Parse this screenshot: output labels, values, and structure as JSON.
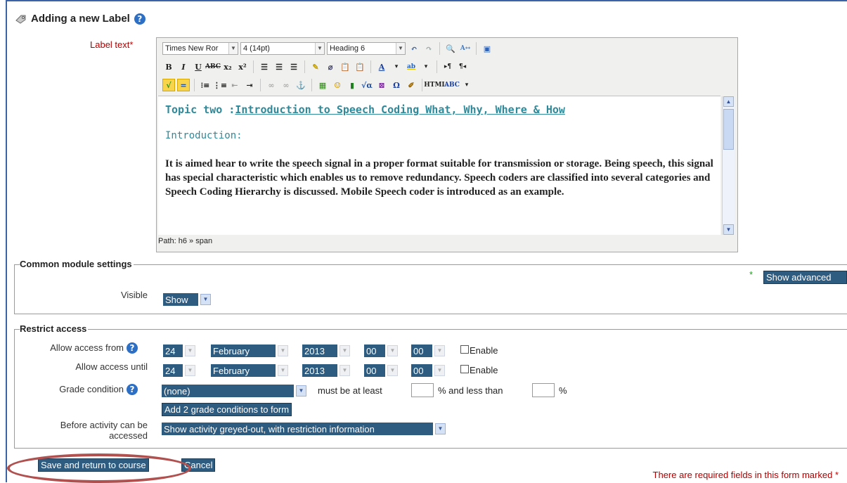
{
  "page": {
    "title": "Adding a new Label"
  },
  "label_field": {
    "label": "Label text",
    "required_mark": "*"
  },
  "editor": {
    "font_family": "Times New Ror",
    "font_size": "4 (14pt)",
    "format": "Heading 6",
    "topic_prefix": "Topic two :",
    "topic_title": "Introduction to Speech Coding What, Why, Where & How",
    "intro_heading": "Introduction:",
    "body": "It is aimed hear to write the speech signal in a proper format suitable for transmission or storage. Being speech, this signal has special characteristic which  enables us to remove redundancy. Speech coders are classified into several categories and Speech Coding Hierarchy is discussed. Mobile Speech coder is introduced as an example.",
    "path": "Path: h6 » span",
    "toolbar_buttons": [
      "B",
      "I",
      "U",
      "ABC",
      "x₂",
      "x²",
      "≡",
      "≡",
      "≡",
      "✓",
      "⊘",
      "📋",
      "📋",
      "A",
      "ab",
      "¶",
      "¶"
    ]
  },
  "common_settings": {
    "legend": "Common module settings",
    "show_advanced": "Show advanced",
    "visible_label": "Visible",
    "visible_value": "Show"
  },
  "restrict": {
    "legend": "Restrict access",
    "from_label": "Allow access from",
    "until_label": "Allow access until",
    "from": {
      "day": "24",
      "month": "February",
      "year": "2013",
      "hour": "00",
      "minute": "00"
    },
    "until": {
      "day": "24",
      "month": "February",
      "year": "2013",
      "hour": "00",
      "minute": "00"
    },
    "enable_label": "Enable",
    "grade_label": "Grade condition",
    "grade_value": "(none)",
    "must_be_at_least": "must be at least",
    "percent_and_less_than": "% and less than",
    "percent": "%",
    "add_conditions": "Add 2 grade conditions to form",
    "before_label_1": "Before activity can be",
    "before_label_2": "accessed",
    "before_value": "Show activity greyed-out, with restriction information"
  },
  "actions": {
    "save": "Save and return to course",
    "cancel": "Cancel"
  },
  "footer": {
    "note": "There are required fields in this form marked",
    "mark": "*"
  }
}
